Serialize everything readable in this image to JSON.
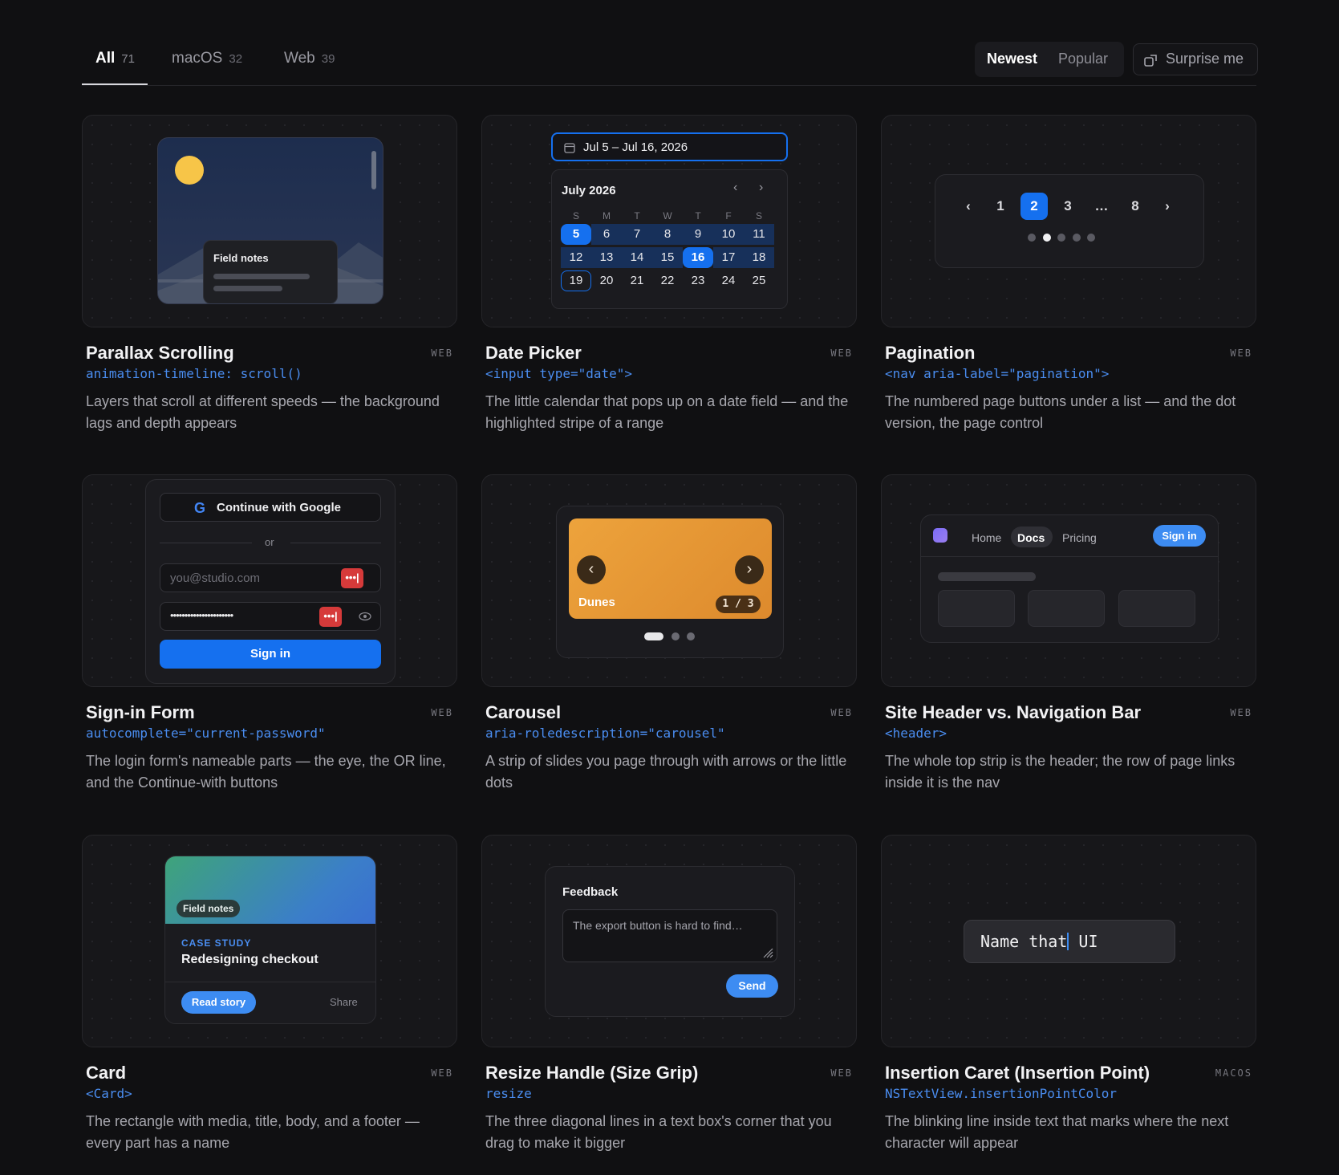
{
  "tabs": [
    {
      "label": "All",
      "count": "71"
    },
    {
      "label": "macOS",
      "count": "32"
    },
    {
      "label": "Web",
      "count": "39"
    }
  ],
  "sort": {
    "newest": "Newest",
    "popular": "Popular"
  },
  "surprise_label": "Surprise me",
  "cards": [
    {
      "title": "Parallax Scrolling",
      "platform": "WEB",
      "code": "animation-timeline: scroll()",
      "desc": "Layers that scroll at different speeds — the background lags and depth appears"
    },
    {
      "title": "Date Picker",
      "platform": "WEB",
      "code": "<input type=\"date\">",
      "desc": "The little calendar that pops up on a date field — and the highlighted stripe of a range"
    },
    {
      "title": "Pagination",
      "platform": "WEB",
      "code": "<nav aria-label=\"pagination\">",
      "desc": "The numbered page buttons under a list — and the dot version, the page control"
    },
    {
      "title": "Sign-in Form",
      "platform": "WEB",
      "code": "autocomplete=\"current-password\"",
      "desc": "The login form's nameable parts — the eye, the OR line, and the Continue-with buttons"
    },
    {
      "title": "Carousel",
      "platform": "WEB",
      "code": "aria-roledescription=\"carousel\"",
      "desc": "A strip of slides you page through with arrows or the little dots"
    },
    {
      "title": "Site Header vs. Navigation Bar",
      "platform": "WEB",
      "code": "<header>",
      "desc": "The whole top strip is the header; the row of page links inside it is the nav"
    },
    {
      "title": "Card",
      "platform": "WEB",
      "code": "<Card>",
      "desc": "The rectangle with media, title, body, and a footer — every part has a name"
    },
    {
      "title": "Resize Handle (Size Grip)",
      "platform": "WEB",
      "code": "resize",
      "desc": "The three diagonal lines in a text box's corner that you drag to make it bigger"
    },
    {
      "title": "Insertion Caret (Insertion Point)",
      "platform": "MACOS",
      "code": "NSTextView.insertionPointColor",
      "desc": "The blinking line inside text that marks where the next character will appear"
    }
  ],
  "parallax": {
    "label": "Field notes"
  },
  "datepicker": {
    "range": "Jul 5 – Jul 16, 2026",
    "month": "July 2026",
    "weekdays": [
      "S",
      "M",
      "T",
      "W",
      "T",
      "F",
      "S"
    ],
    "rows": [
      [
        "5",
        "6",
        "7",
        "8",
        "9",
        "10",
        "11"
      ],
      [
        "12",
        "13",
        "14",
        "15",
        "16",
        "17",
        "18"
      ],
      [
        "19",
        "20",
        "21",
        "22",
        "23",
        "24",
        "25"
      ]
    ]
  },
  "pagination": {
    "pages": [
      "1",
      "2",
      "3",
      "…",
      "8"
    ],
    "current": "2",
    "dot_count": 5,
    "active_dot": 2
  },
  "signin": {
    "google": "Continue with Google",
    "or": "or",
    "email_placeholder": "you@studio.com",
    "password_mask": "••••••••••••••••••••••",
    "submit": "Sign in"
  },
  "carousel": {
    "slide_label": "Dunes",
    "counter": "1 / 3"
  },
  "siteheader": {
    "links": [
      "Home",
      "Docs",
      "Pricing"
    ],
    "active": "Docs",
    "button": "Sign in"
  },
  "cardpreview": {
    "badge": "Field notes",
    "kicker": "CASE STUDY",
    "heading": "Redesigning checkout",
    "primary": "Read story",
    "secondary": "Share"
  },
  "resize": {
    "label": "Feedback",
    "text": "The export button is hard to find…",
    "send": "Send"
  },
  "caret": {
    "before": "Name that",
    "after": " UI"
  },
  "colors": {
    "accent": "#1570ef",
    "page_bg": "#101012",
    "card_bg": "#17171a",
    "code": "#4a8df0"
  }
}
